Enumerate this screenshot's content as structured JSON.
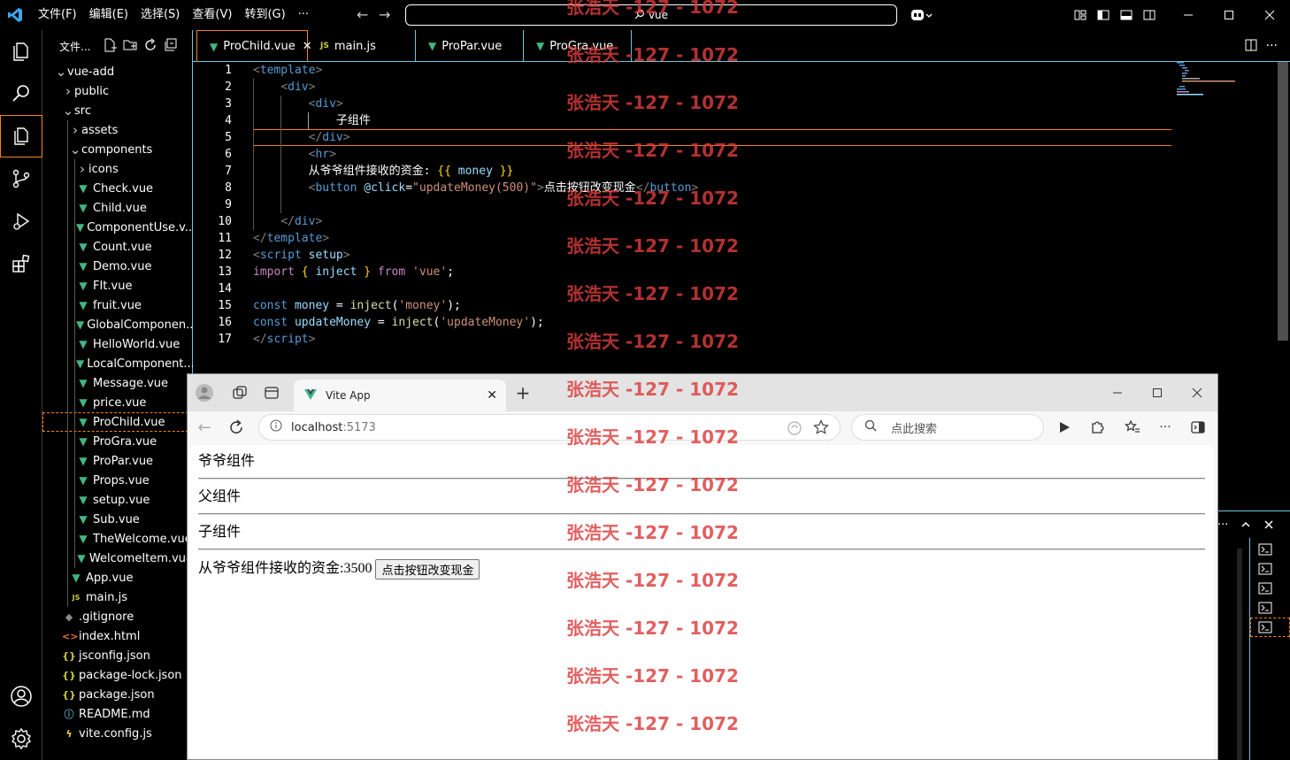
{
  "titlebar": {
    "menus": [
      "文件(F)",
      "编辑(E)",
      "选择(S)",
      "查看(V)",
      "转到(G)",
      "···"
    ],
    "search_text": "vue",
    "accent": "#f38518",
    "border": "#6fc3df"
  },
  "sidebar": {
    "header": "文件...",
    "rows": [
      {
        "label": "vue-add",
        "depth": 0,
        "chev": "v",
        "icon": ""
      },
      {
        "label": "public",
        "depth": 1,
        "chev": ">",
        "icon": ""
      },
      {
        "label": "src",
        "depth": 1,
        "chev": "v",
        "icon": ""
      },
      {
        "label": "assets",
        "depth": 2,
        "chev": ">",
        "icon": ""
      },
      {
        "label": "components",
        "depth": 2,
        "chev": "v",
        "icon": ""
      },
      {
        "label": "icons",
        "depth": 3,
        "chev": ">",
        "icon": ""
      },
      {
        "label": "Check.vue",
        "depth": 3,
        "chev": "",
        "icon": "vue"
      },
      {
        "label": "Child.vue",
        "depth": 3,
        "chev": "",
        "icon": "vue"
      },
      {
        "label": "ComponentUse.v...",
        "depth": 3,
        "chev": "",
        "icon": "vue"
      },
      {
        "label": "Count.vue",
        "depth": 3,
        "chev": "",
        "icon": "vue"
      },
      {
        "label": "Demo.vue",
        "depth": 3,
        "chev": "",
        "icon": "vue"
      },
      {
        "label": "FIt.vue",
        "depth": 3,
        "chev": "",
        "icon": "vue"
      },
      {
        "label": "fruit.vue",
        "depth": 3,
        "chev": "",
        "icon": "vue"
      },
      {
        "label": "GlobalComponen...",
        "depth": 3,
        "chev": "",
        "icon": "vue"
      },
      {
        "label": "HelloWorld.vue",
        "depth": 3,
        "chev": "",
        "icon": "vue"
      },
      {
        "label": "LocalComponent...",
        "depth": 3,
        "chev": "",
        "icon": "vue"
      },
      {
        "label": "Message.vue",
        "depth": 3,
        "chev": "",
        "icon": "vue"
      },
      {
        "label": "price.vue",
        "depth": 3,
        "chev": "",
        "icon": "vue"
      },
      {
        "label": "ProChild.vue",
        "depth": 3,
        "chev": "",
        "icon": "vue",
        "selected": true
      },
      {
        "label": "ProGra.vue",
        "depth": 3,
        "chev": "",
        "icon": "vue"
      },
      {
        "label": "ProPar.vue",
        "depth": 3,
        "chev": "",
        "icon": "vue"
      },
      {
        "label": "Props.vue",
        "depth": 3,
        "chev": "",
        "icon": "vue"
      },
      {
        "label": "setup.vue",
        "depth": 3,
        "chev": "",
        "icon": "vue"
      },
      {
        "label": "Sub.vue",
        "depth": 3,
        "chev": "",
        "icon": "vue"
      },
      {
        "label": "TheWelcome.vue",
        "depth": 3,
        "chev": "",
        "icon": "vue"
      },
      {
        "label": "WelcomeItem.vue",
        "depth": 3,
        "chev": "",
        "icon": "vue"
      },
      {
        "label": "App.vue",
        "depth": 2,
        "chev": "",
        "icon": "vue"
      },
      {
        "label": "main.js",
        "depth": 2,
        "chev": "",
        "icon": "js"
      },
      {
        "label": ".gitignore",
        "depth": 1,
        "chev": "",
        "icon": "git"
      },
      {
        "label": "index.html",
        "depth": 1,
        "chev": "",
        "icon": "html"
      },
      {
        "label": "jsconfig.json",
        "depth": 1,
        "chev": "",
        "icon": "json"
      },
      {
        "label": "package-lock.json",
        "depth": 1,
        "chev": "",
        "icon": "json"
      },
      {
        "label": "package.json",
        "depth": 1,
        "chev": "",
        "icon": "json"
      },
      {
        "label": "README.md",
        "depth": 1,
        "chev": "",
        "icon": "info"
      },
      {
        "label": "vite.config.js",
        "depth": 1,
        "chev": "",
        "icon": "vite"
      }
    ]
  },
  "tabs": [
    {
      "label": "ProChild.vue",
      "icon": "vue",
      "active": true
    },
    {
      "label": "main.js",
      "icon": "js"
    },
    {
      "label": "ProPar.vue",
      "icon": "vue"
    },
    {
      "label": "ProGra.vue",
      "icon": "vue"
    }
  ],
  "editor": {
    "line_numbers": [
      "1",
      "2",
      "3",
      "4",
      "5",
      "6",
      "7",
      "8",
      "9",
      "10",
      "11",
      "12",
      "13",
      "14",
      "15",
      "16",
      "17"
    ],
    "lines": [
      [
        [
          "br",
          "<"
        ],
        [
          "tag",
          "template"
        ],
        [
          "br",
          ">"
        ]
      ],
      [
        [
          "t",
          "    "
        ],
        [
          "br",
          "<"
        ],
        [
          "tag",
          "div"
        ],
        [
          "br",
          ">"
        ]
      ],
      [
        [
          "t",
          "        "
        ],
        [
          "br",
          "<"
        ],
        [
          "tag",
          "div"
        ],
        [
          "br",
          ">"
        ]
      ],
      [
        [
          "t",
          "            子组件"
        ]
      ],
      [
        [
          "t",
          "        "
        ],
        [
          "br",
          "</"
        ],
        [
          "tag",
          "div"
        ],
        [
          "br",
          ">"
        ]
      ],
      [
        [
          "t",
          "        "
        ],
        [
          "br",
          "<"
        ],
        [
          "tag",
          "hr"
        ],
        [
          "br",
          ">"
        ]
      ],
      [
        [
          "t",
          "        从爷爷组件接收的资金: "
        ],
        [
          "brace",
          "{{ "
        ],
        [
          "var",
          "money"
        ],
        [
          "brace",
          " }}"
        ]
      ],
      [
        [
          "t",
          "        "
        ],
        [
          "br",
          "<"
        ],
        [
          "tag",
          "button"
        ],
        [
          "t",
          " "
        ],
        [
          "attr",
          "@click"
        ],
        [
          "t",
          "="
        ],
        [
          "str",
          "\"updateMoney(500)\""
        ],
        [
          "br",
          ">"
        ],
        [
          "t",
          "点击按钮改变现金"
        ],
        [
          "br",
          "</"
        ],
        [
          "tag",
          "button"
        ],
        [
          "br",
          ">"
        ]
      ],
      [
        [
          "t",
          ""
        ]
      ],
      [
        [
          "t",
          "    "
        ],
        [
          "br",
          "</"
        ],
        [
          "tag",
          "div"
        ],
        [
          "br",
          ">"
        ]
      ],
      [
        [
          "br",
          "</"
        ],
        [
          "tag",
          "template"
        ],
        [
          "br",
          ">"
        ]
      ],
      [
        [
          "br",
          "<"
        ],
        [
          "tag",
          "script"
        ],
        [
          "t",
          " "
        ],
        [
          "attr",
          "setup"
        ],
        [
          "br",
          ">"
        ]
      ],
      [
        [
          "kw",
          "import"
        ],
        [
          "t",
          " "
        ],
        [
          "brace",
          "{"
        ],
        [
          "t",
          " "
        ],
        [
          "var",
          "inject"
        ],
        [
          "t",
          " "
        ],
        [
          "brace",
          "}"
        ],
        [
          "t",
          " "
        ],
        [
          "kw",
          "from"
        ],
        [
          "t",
          " "
        ],
        [
          "str",
          "'vue'"
        ],
        [
          "t",
          ";"
        ]
      ],
      [
        [
          "t",
          ""
        ]
      ],
      [
        [
          "key",
          "const"
        ],
        [
          "t",
          " "
        ],
        [
          "var",
          "money"
        ],
        [
          "t",
          " = "
        ],
        [
          "fn",
          "inject"
        ],
        [
          "t",
          "("
        ],
        [
          "str",
          "'money'"
        ],
        [
          "t",
          ");"
        ]
      ],
      [
        [
          "key",
          "const"
        ],
        [
          "t",
          " "
        ],
        [
          "var",
          "updateMoney"
        ],
        [
          "t",
          " = "
        ],
        [
          "fn",
          "inject"
        ],
        [
          "t",
          "("
        ],
        [
          "str",
          "'updateMoney'"
        ],
        [
          "t",
          ");"
        ]
      ],
      [
        [
          "br",
          "</"
        ],
        [
          "tag",
          "script"
        ],
        [
          "br",
          ">"
        ]
      ]
    ]
  },
  "browser": {
    "tab_title": "Vite App",
    "address_host": "localhost",
    "address_port": ":5173",
    "search_placeholder": "点此搜索",
    "content": {
      "grandparent": "爷爷组件",
      "parent": "父组件",
      "child": "子组件",
      "money_label": "从爷爷组件接收的资金:",
      "money_value": "3500",
      "button_label": "点击按钮改变现金"
    }
  },
  "watermark": {
    "text": "张浩天 -127 - 1072"
  }
}
